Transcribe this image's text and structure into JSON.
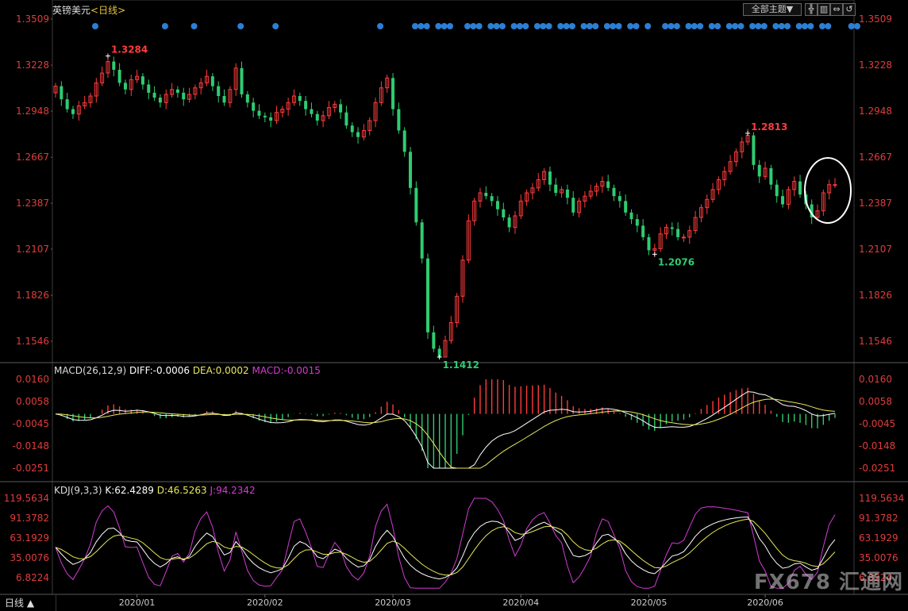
{
  "header": {
    "symbol": "英镑美元",
    "period": "<日线>",
    "theme_button": "全部主题▼"
  },
  "bottom_tab": "日线 ▲",
  "watermark": "FX678 汇通网",
  "colors": {
    "up": "#ff3b3b",
    "down": "#2ecc71",
    "price_axis": "#e03c3c",
    "macd_axis": "#e03c3c",
    "kdj_axis": "#e03c3c",
    "diff": "#ffffff",
    "dea": "#e8e85a",
    "macd": "#d23cd2",
    "k": "#ffffff",
    "d": "#e8e85a",
    "j": "#d23cd2",
    "dots": "#2b7fd4",
    "circle": "#ffffff"
  },
  "chart_data": [
    {
      "type": "candlestick",
      "title": "英镑美元<日线>",
      "y_ticks": [
        "1.3509",
        "1.3228",
        "1.2948",
        "1.2667",
        "1.2387",
        "1.2107",
        "1.1826",
        "1.1546"
      ],
      "ylim": [
        1.1546,
        1.3509
      ],
      "x_ticks": [
        "2020/01",
        "2020/02",
        "2020/03",
        "2020/04",
        "2020/05",
        "2020/06"
      ],
      "annotations": [
        {
          "text": "1.3284",
          "value": 1.3284,
          "type": "high"
        },
        {
          "text": "1.1412",
          "value": 1.1412,
          "type": "low"
        },
        {
          "text": "1.2813",
          "value": 1.2813,
          "type": "high"
        },
        {
          "text": "1.2076",
          "value": 1.2076,
          "type": "low"
        }
      ],
      "close": [
        1.31,
        1.302,
        1.296,
        1.293,
        1.298,
        1.3,
        1.304,
        1.312,
        1.318,
        1.325,
        1.32,
        1.312,
        1.308,
        1.314,
        1.316,
        1.311,
        1.306,
        1.303,
        1.3,
        1.305,
        1.308,
        1.306,
        1.302,
        1.305,
        1.309,
        1.312,
        1.316,
        1.31,
        1.304,
        1.3,
        1.308,
        1.321,
        1.305,
        1.3,
        1.295,
        1.292,
        1.291,
        1.289,
        1.294,
        1.296,
        1.3,
        1.304,
        1.301,
        1.296,
        1.293,
        1.289,
        1.292,
        1.297,
        1.299,
        1.294,
        1.286,
        1.282,
        1.279,
        1.283,
        1.289,
        1.3,
        1.309,
        1.315,
        1.296,
        1.283,
        1.27,
        1.248,
        1.227,
        1.205,
        1.16,
        1.15,
        1.141,
        1.155,
        1.166,
        1.182,
        1.204,
        1.228,
        1.24,
        1.245,
        1.243,
        1.24,
        1.235,
        1.23,
        1.224,
        1.231,
        1.24,
        1.245,
        1.248,
        1.253,
        1.258,
        1.25,
        1.245,
        1.247,
        1.242,
        1.233,
        1.24,
        1.243,
        1.246,
        1.249,
        1.252,
        1.248,
        1.243,
        1.24,
        1.233,
        1.229,
        1.225,
        1.218,
        1.21,
        1.211,
        1.22,
        1.224,
        1.223,
        1.218,
        1.218,
        1.222,
        1.23,
        1.236,
        1.241,
        1.247,
        1.253,
        1.258,
        1.264,
        1.27,
        1.276,
        1.28,
        1.262,
        1.255,
        1.26,
        1.25,
        1.243,
        1.238,
        1.247,
        1.252,
        1.244,
        1.238,
        1.23,
        1.234,
        1.245,
        1.25,
        1.25
      ],
      "open": [
        1.306,
        1.31,
        1.302,
        1.296,
        1.293,
        1.298,
        1.3,
        1.304,
        1.312,
        1.318,
        1.325,
        1.32,
        1.312,
        1.308,
        1.314,
        1.316,
        1.311,
        1.306,
        1.303,
        1.3,
        1.305,
        1.308,
        1.306,
        1.302,
        1.305,
        1.309,
        1.312,
        1.316,
        1.31,
        1.304,
        1.3,
        1.308,
        1.321,
        1.305,
        1.3,
        1.295,
        1.292,
        1.291,
        1.289,
        1.294,
        1.296,
        1.3,
        1.304,
        1.301,
        1.296,
        1.293,
        1.289,
        1.292,
        1.297,
        1.299,
        1.294,
        1.286,
        1.282,
        1.279,
        1.283,
        1.289,
        1.3,
        1.309,
        1.315,
        1.296,
        1.283,
        1.27,
        1.248,
        1.227,
        1.205,
        1.16,
        1.15,
        1.141,
        1.155,
        1.166,
        1.182,
        1.204,
        1.228,
        1.24,
        1.245,
        1.243,
        1.24,
        1.235,
        1.23,
        1.224,
        1.231,
        1.24,
        1.245,
        1.248,
        1.253,
        1.258,
        1.25,
        1.245,
        1.247,
        1.242,
        1.233,
        1.24,
        1.243,
        1.246,
        1.249,
        1.252,
        1.248,
        1.243,
        1.24,
        1.233,
        1.229,
        1.225,
        1.218,
        1.21,
        1.211,
        1.22,
        1.224,
        1.223,
        1.218,
        1.218,
        1.222,
        1.23,
        1.236,
        1.241,
        1.247,
        1.253,
        1.258,
        1.264,
        1.27,
        1.276,
        1.28,
        1.262,
        1.255,
        1.26,
        1.25,
        1.243,
        1.238,
        1.247,
        1.252,
        1.244,
        1.238,
        1.23,
        1.234,
        1.245,
        1.25
      ]
    },
    {
      "type": "macd",
      "title": "MACD(26,12,9)",
      "params_label": "MACD(26,12,9)",
      "diff_label": "DIFF:-0.0006",
      "dea_label": "DEA:0.0002",
      "macd_label": "MACD:-0.0015",
      "y_ticks": [
        "0.0160",
        "0.0058",
        "-0.0045",
        "-0.0148",
        "-0.0251"
      ],
      "ylim": [
        -0.0251,
        0.016
      ]
    },
    {
      "type": "kdj",
      "title": "KDJ(9,3,3)",
      "params_label": "KDJ(9,3,3)",
      "k_label": "K:62.4289",
      "d_label": "D:46.5263",
      "j_label": "J:94.2342",
      "y_ticks": [
        "119.5634",
        "91.3782",
        "63.1929",
        "35.0076",
        "6.8224"
      ],
      "ylim": [
        6.8224,
        119.5634
      ]
    }
  ]
}
